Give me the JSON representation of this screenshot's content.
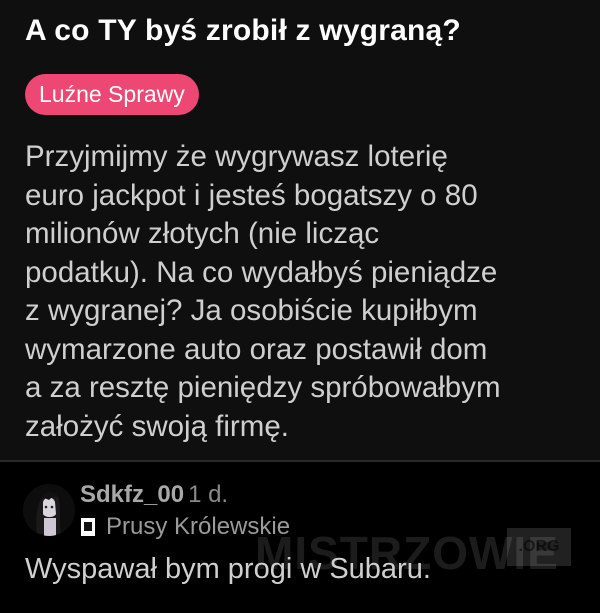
{
  "post": {
    "title": "A co TY byś zrobił z wygraną?",
    "tag": "Luźne Sprawy",
    "body_lines": [
      "Przyjmijmy że wygrywasz loterię",
      "euro jackpot i jesteś bogatszy o 80",
      "milionów złotych (nie licząc",
      "podatku). Na co wydałbyś pieniądze",
      "z wygranej? Ja osobiście kupiłbym",
      "wymarzone auto oraz postawił dom",
      "a za resztę pieniędzy spróbowałbym",
      "założyć swoją firmę."
    ]
  },
  "comment": {
    "username": "Sdkfz_00",
    "time": "1 d.",
    "location": "Prusy Królewskie",
    "text": "Wyspawał bym progi w Subaru."
  },
  "watermark": {
    "text": "MISTRZOWIE",
    "suffix": ".ORG"
  },
  "colors": {
    "tag_background": "#ec4873",
    "post_background": "#0f0f0f",
    "comment_background": "#000000"
  }
}
